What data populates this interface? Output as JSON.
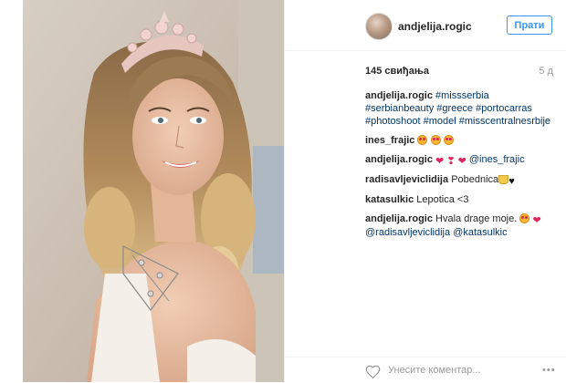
{
  "post": {
    "username": "andjelija.rogic",
    "follow_label": "Прати",
    "likes": "145 свиђања",
    "age": "5 д"
  },
  "comments": [
    {
      "user": "andjelija.rogic",
      "tags": [
        "#missserbia",
        "#serbianbeauty",
        "#greece",
        "#portocarras",
        "#photoshoot",
        "#model",
        "#misscentralnesrbije"
      ]
    },
    {
      "user": "ines_frajic",
      "emojis": [
        "heart-eyes-face-icon",
        "heart-eyes-face-icon",
        "heart-eyes-face-icon"
      ]
    },
    {
      "user": "andjelija.rogic",
      "emojis": [
        "red-heart-icon",
        "two-hearts-icon",
        "red-heart-icon"
      ],
      "mention": "@ines_frajic"
    },
    {
      "user": "radisavljeviclidija",
      "text": "Pobednica",
      "emojis": [
        "trophy-icon",
        "black-heart-icon"
      ]
    },
    {
      "user": "katasulkic",
      "text": "Lepotica <3"
    },
    {
      "user": "andjelija.rogic",
      "text": "Hvala drage moje.",
      "emojis": [
        "heart-eyes-face-icon",
        "red-heart-icon"
      ],
      "mentions": [
        "@radisavljeviclidija",
        "@katasulkic"
      ]
    }
  ],
  "footer": {
    "comment_placeholder": "Унесите коментар...",
    "more_label": "•••"
  },
  "colors": {
    "accent": "#3897f0",
    "hashtag": "#003569",
    "heart": "#e0245e"
  }
}
